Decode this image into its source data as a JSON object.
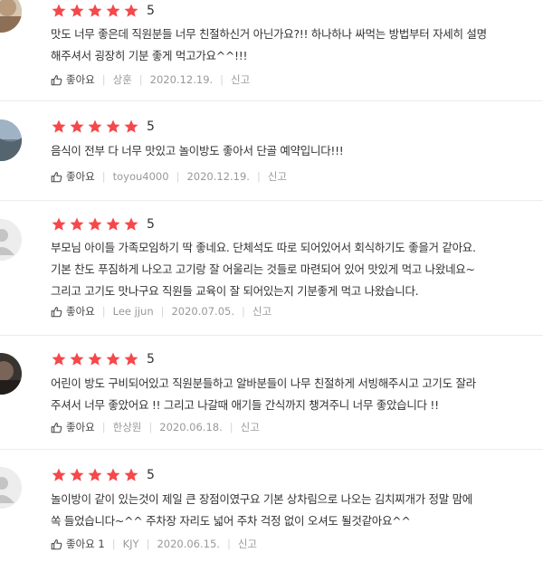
{
  "colors": {
    "star": "#f5484b",
    "divider": "#ececec",
    "meta": "#999999"
  },
  "reviews": [
    {
      "score": "5",
      "text": "맛도 너무 좋은데 직원분들 너무 친절하신거 아닌가요?!! 하나하나 싸먹는 방법부터 자세히 설명\n해주셔서  굉장히 기분 좋게 먹고가요^^!!!",
      "like_label": "좋아요",
      "author": "상훈",
      "date": "2020.12.19.",
      "report_label": "신고"
    },
    {
      "score": "5",
      "text": "음식이 전부 다 너무 맛있고 놀이방도 좋아서 단골 예약입니다!!!",
      "like_label": "좋아요",
      "author": "toyou4000",
      "date": "2020.12.19.",
      "report_label": "신고"
    },
    {
      "score": "5",
      "text": "부모님 아이들 가족모임하기 딱 좋네요. 단체석도 따로 되어있어서 회식하기도 좋을거 같아요.\n기본 찬도 푸짐하게 나오고 고기랑 잘 어울리는 것들로 마련되어 있어 맛있게 먹고 나왔네요~\n그리고 고기도 맛나구요 직원들 교육이 잘 되어있는지 기분좋게 먹고 나왔습니다.",
      "like_label": "좋아요",
      "author": "Lee jjun",
      "date": "2020.07.05.",
      "report_label": "신고"
    },
    {
      "score": "5",
      "text": "어린이 방도 구비되어있고 직원분들하고 알바분들이 나무 친절하게 서빙해주시고 고기도 잘라\n주셔서 너무 좋았어요 !! 그리고 나갈때 애기들 간식까지 챙겨주니 너무 좋았습니다 !!",
      "like_label": "좋아요",
      "author": "한상원",
      "date": "2020.06.18.",
      "report_label": "신고"
    },
    {
      "score": "5",
      "text": "놀이방이 같이 있는것이 제일 큰 장점이였구요  기본 상차림으로 나오는 김치찌개가 정말 맘에\n쏙 들었습니다~^^ 주차장 자리도 넓어 주차 걱정 없이 오셔도 될것같아요^^",
      "like_label": "좋아요 1",
      "author": "KJY",
      "date": "2020.06.15.",
      "report_label": "신고"
    }
  ]
}
